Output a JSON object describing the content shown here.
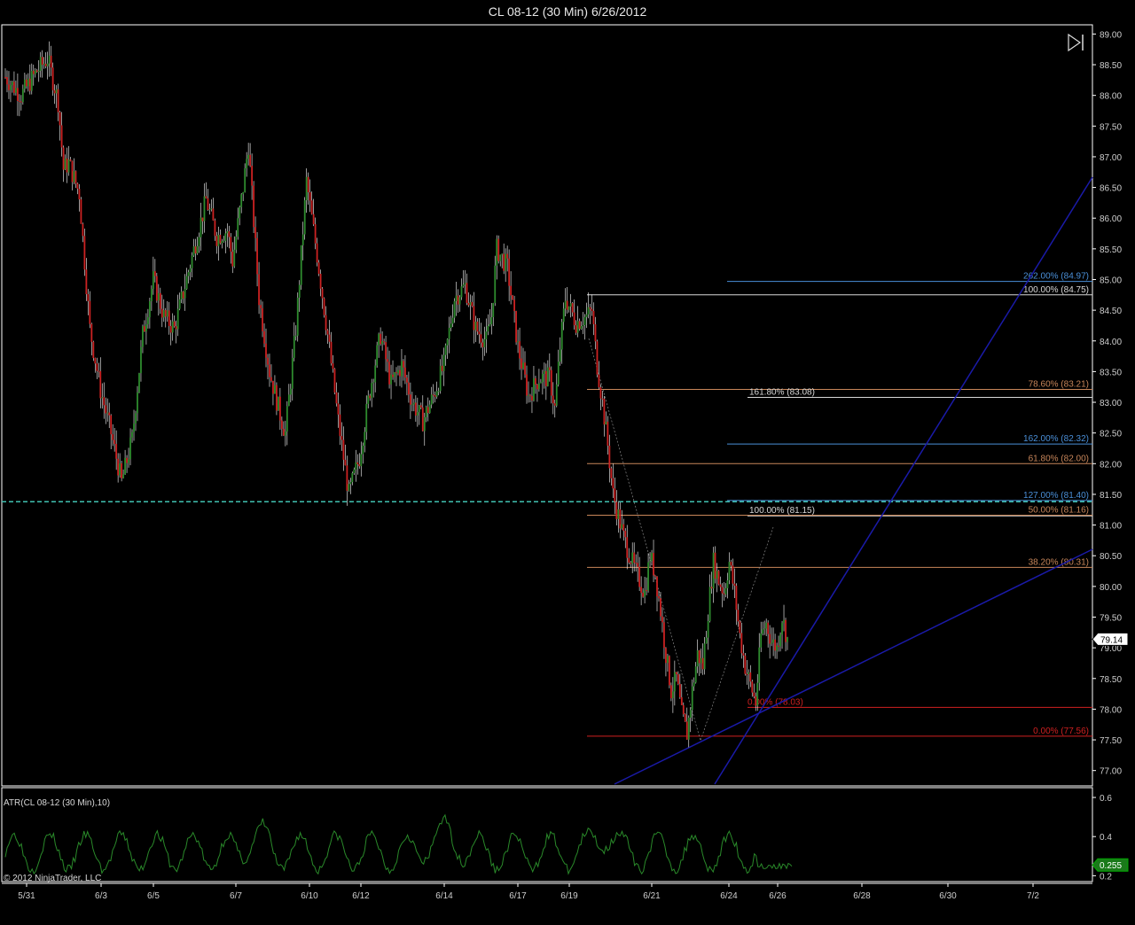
{
  "title": "CL 08-12 (30 Min)  6/26/2012",
  "copyright": "© 2012 NinjaTrader, LLC",
  "atr_label": "ATR(CL 08-12 (30 Min),10)",
  "colors": {
    "background": "#000000",
    "axis": "#ffffff",
    "candle_up": "#2e8b2e",
    "candle_down": "#cc2222",
    "wick": "#ffffff",
    "support_line": "#40c0b0",
    "trendline": "#1a1aa8",
    "fib_tan": "#c8865a",
    "fib_blue": "#4a8fd8",
    "fib_red": "#d02020",
    "fib_white": "#d8d8d8",
    "atr_line": "#2a8a2a"
  },
  "chart_data": [
    {
      "type": "candlestick",
      "title": "CL 08-12 (30 Min)  6/26/2012",
      "ylim": [
        76.75,
        89.15
      ],
      "y_ticks": [
        77.0,
        77.5,
        78.0,
        78.5,
        79.0,
        79.5,
        80.0,
        80.5,
        81.0,
        81.5,
        82.0,
        82.5,
        83.0,
        83.5,
        84.0,
        84.5,
        85.0,
        85.5,
        86.0,
        86.5,
        87.0,
        87.5,
        88.0,
        88.5,
        89.0
      ],
      "x_labels": [
        "5/31",
        "6/3",
        "6/5",
        "6/7",
        "6/10",
        "6/12",
        "6/14",
        "6/17",
        "6/19",
        "6/21",
        "6/24",
        "6/26",
        "6/28",
        "6/30",
        "7/2"
      ],
      "last_price": "79.14",
      "price_path": [
        [
          0,
          88.3
        ],
        [
          3,
          88.0
        ],
        [
          6,
          88.4
        ],
        [
          8,
          88.6
        ],
        [
          10,
          87.9
        ],
        [
          11,
          86.8
        ],
        [
          12,
          86.9
        ],
        [
          14,
          86.4
        ],
        [
          16,
          84.2
        ],
        [
          18,
          83.2
        ],
        [
          20,
          82.5
        ],
        [
          22,
          81.7
        ],
        [
          24,
          82.4
        ],
        [
          26,
          84.1
        ],
        [
          28,
          85.0
        ],
        [
          30,
          84.4
        ],
        [
          32,
          84.2
        ],
        [
          34,
          84.9
        ],
        [
          36,
          85.6
        ],
        [
          38,
          86.3
        ],
        [
          40,
          85.7
        ],
        [
          42,
          85.8
        ],
        [
          43,
          85.3
        ],
        [
          45,
          86.5
        ],
        [
          46,
          87.2
        ],
        [
          48,
          84.7
        ],
        [
          50,
          83.5
        ],
        [
          52,
          82.8
        ],
        [
          53,
          82.5
        ],
        [
          55,
          84.2
        ],
        [
          57,
          86.6
        ],
        [
          59,
          85.4
        ],
        [
          61,
          84.1
        ],
        [
          63,
          82.7
        ],
        [
          65,
          81.5
        ],
        [
          67,
          82.1
        ],
        [
          69,
          83.2
        ],
        [
          71,
          84.1
        ],
        [
          73,
          83.3
        ],
        [
          75,
          83.6
        ],
        [
          77,
          83.0
        ],
        [
          79,
          82.7
        ],
        [
          81,
          83.1
        ],
        [
          83,
          83.6
        ],
        [
          85,
          84.7
        ],
        [
          87,
          84.9
        ],
        [
          89,
          84.2
        ],
        [
          91,
          84.0
        ],
        [
          92,
          84.4
        ],
        [
          93,
          85.5
        ],
        [
          95,
          85.2
        ],
        [
          97,
          83.9
        ],
        [
          99,
          83.1
        ],
        [
          101,
          83.4
        ],
        [
          103,
          83.4
        ],
        [
          104,
          82.9
        ],
        [
          105,
          83.9
        ],
        [
          106,
          84.7
        ],
        [
          108,
          84.3
        ],
        [
          110,
          84.4
        ],
        [
          111,
          84.5
        ],
        [
          112,
          83.6
        ],
        [
          113,
          83.0
        ],
        [
          114,
          82.3
        ],
        [
          115,
          81.5
        ],
        [
          117,
          80.8
        ],
        [
          119,
          80.3
        ],
        [
          121,
          79.9
        ],
        [
          122,
          80.5
        ],
        [
          123,
          80.2
        ],
        [
          124,
          79.6
        ],
        [
          125,
          78.9
        ],
        [
          126,
          78.3
        ],
        [
          127,
          78.5
        ],
        [
          128,
          77.9
        ],
        [
          129,
          77.6
        ],
        [
          130,
          78.3
        ],
        [
          131,
          78.9
        ],
        [
          132,
          78.7
        ],
        [
          133,
          79.6
        ],
        [
          134,
          80.4
        ],
        [
          135,
          80.1
        ],
        [
          136,
          79.9
        ],
        [
          137,
          80.4
        ],
        [
          138,
          79.9
        ],
        [
          139,
          79.2
        ],
        [
          140,
          78.7
        ],
        [
          141,
          78.4
        ],
        [
          142,
          78.1
        ],
        [
          143,
          79.2
        ],
        [
          144,
          79.4
        ],
        [
          145,
          79.1
        ],
        [
          146,
          79.0
        ],
        [
          147,
          79.5
        ],
        [
          148,
          79.14
        ]
      ],
      "fib_levels": [
        {
          "label": "262.00% (84.97)",
          "price": 84.97,
          "color": "blue"
        },
        {
          "label": "100.00% (84.75)",
          "price": 84.75,
          "color": "white"
        },
        {
          "label": "78.60% (83.21)",
          "price": 83.21,
          "color": "tan"
        },
        {
          "label": "161.80% (83.08)",
          "price": 83.08,
          "color": "white"
        },
        {
          "label": "162.00% (82.32)",
          "price": 82.32,
          "color": "blue"
        },
        {
          "label": "61.80% (82.00)",
          "price": 82.0,
          "color": "tan"
        },
        {
          "label": "127.00% (81.40)",
          "price": 81.4,
          "color": "blue"
        },
        {
          "label": "100.00% (81.15)",
          "price": 81.15,
          "color": "white"
        },
        {
          "label": "50.00% (81.16)",
          "price": 81.16,
          "color": "tan"
        },
        {
          "label": "38.20% (80.31)",
          "price": 80.31,
          "color": "tan"
        },
        {
          "label": "0.00% (78.03)",
          "price": 78.03,
          "color": "red"
        },
        {
          "label": "0.00% (77.56)",
          "price": 77.56,
          "color": "red"
        }
      ],
      "support_level": 81.38
    },
    {
      "type": "line",
      "title": "ATR(CL 08-12 (30 Min),10)",
      "ylim": [
        0.17,
        0.65
      ],
      "y_ticks": [
        0.2,
        0.4,
        0.6
      ],
      "last_value": "0.255"
    }
  ]
}
